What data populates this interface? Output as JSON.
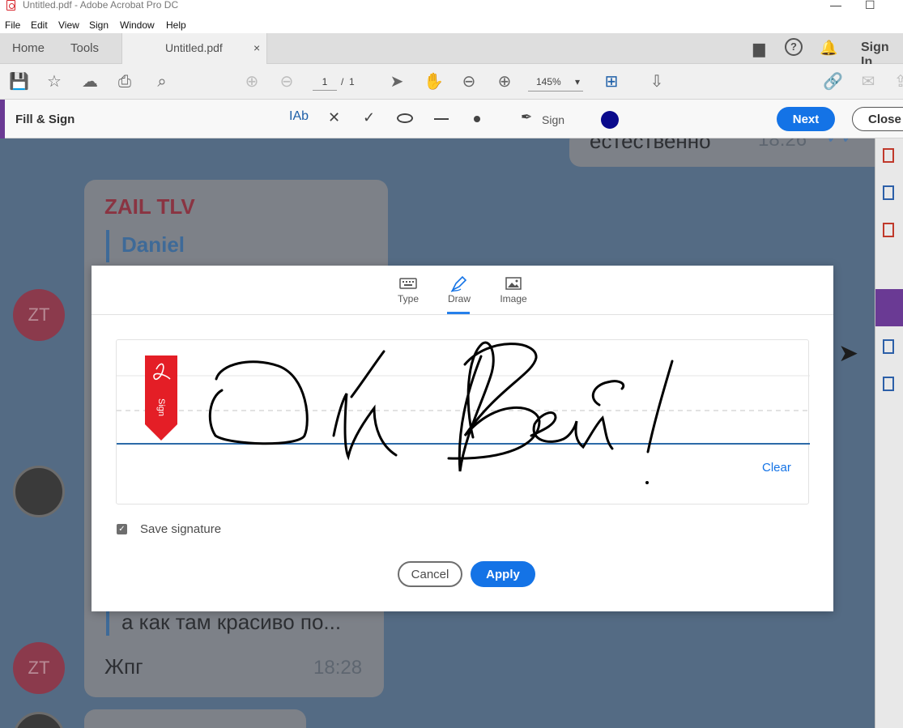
{
  "window": {
    "title": "Untitled.pdf - Adobe Acrobat Pro DC"
  },
  "menu": [
    "File",
    "Edit",
    "View",
    "Sign",
    "Window",
    "Help"
  ],
  "tabs": {
    "home": "Home",
    "tools": "Tools",
    "document": "Untitled.pdf",
    "doc_close": "×",
    "sign_in": "Sign In"
  },
  "toolbar": {
    "page_current": "1",
    "page_sep": "/",
    "page_total": "1",
    "zoom": "145%"
  },
  "fill_sign": {
    "title": "Fill & Sign",
    "text_tool": "IAb",
    "sign_label": "Sign",
    "next": "Next",
    "close": "Close",
    "color": "#0a0a8c"
  },
  "chat": {
    "msg_top": "естественно",
    "msg_top_time": "18:26",
    "sender": "ZAIL TLV",
    "reply_name": "Daniel",
    "avatar_initials": "ZT",
    "reply_text": "а как там красиво по...",
    "msg_text": "Жпг",
    "msg_time": "18:28"
  },
  "dialog": {
    "tabs": [
      {
        "label": "Type",
        "icon": "keyboard-icon"
      },
      {
        "label": "Draw",
        "icon": "pen-icon"
      },
      {
        "label": "Image",
        "icon": "image-icon"
      }
    ],
    "active_tab": "Draw",
    "bookmark_label": "Sign",
    "clear": "Clear",
    "save_signature": "Save signature",
    "save_checked": true,
    "cancel": "Cancel",
    "apply": "Apply"
  },
  "colors": {
    "accent": "#1473e6",
    "doc_bg": "#546b84",
    "sign_flag": "#e41e26"
  }
}
